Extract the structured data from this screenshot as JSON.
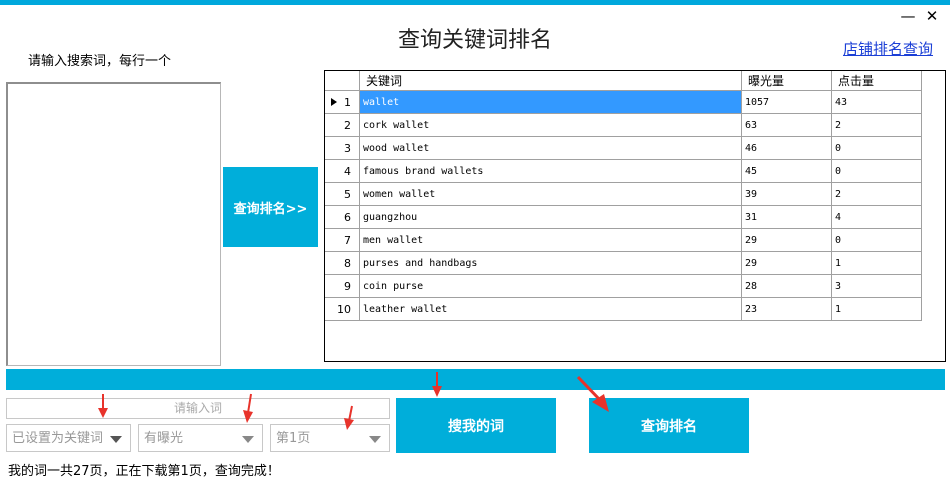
{
  "window": {
    "title": "查询关键词排名",
    "minimize_glyph": "—",
    "close_glyph": "✕"
  },
  "shop_link": "店铺排名查询",
  "input_hint": "请输入搜索词，每行一个",
  "query_rank_arrow_button": "查询排名>>",
  "grid": {
    "columns": [
      "关键词",
      "曝光量",
      "点击量"
    ],
    "selected_row": 1,
    "rows": [
      {
        "no": "1",
        "keyword": "wallet",
        "exposure": "1057",
        "clicks": "43"
      },
      {
        "no": "2",
        "keyword": "cork wallet",
        "exposure": "63",
        "clicks": "2"
      },
      {
        "no": "3",
        "keyword": "wood wallet",
        "exposure": "46",
        "clicks": "0"
      },
      {
        "no": "4",
        "keyword": "famous brand wallets",
        "exposure": "45",
        "clicks": "0"
      },
      {
        "no": "5",
        "keyword": "women wallet",
        "exposure": "39",
        "clicks": "2"
      },
      {
        "no": "6",
        "keyword": "guangzhou",
        "exposure": "31",
        "clicks": "4"
      },
      {
        "no": "7",
        "keyword": "men wallet",
        "exposure": "29",
        "clicks": "0"
      },
      {
        "no": "8",
        "keyword": "purses and handbags",
        "exposure": "29",
        "clicks": "1"
      },
      {
        "no": "9",
        "keyword": "coin purse",
        "exposure": "28",
        "clicks": "3"
      },
      {
        "no": "10",
        "keyword": "leather wallet",
        "exposure": "23",
        "clicks": "1"
      }
    ]
  },
  "bottom": {
    "input_placeholder": "请输入词",
    "combo_keyword": "已设置为关键词",
    "combo_exposure": "有曝光",
    "combo_page": "第1页",
    "search_my_words": "搜我的词",
    "query_rank": "查询排名",
    "status": "我的词一共27页，正在下载第1页，查询完成！"
  },
  "colors": {
    "accent": "#00aeda",
    "selection": "#3399ff",
    "annotation_arrow": "#e8332b"
  }
}
